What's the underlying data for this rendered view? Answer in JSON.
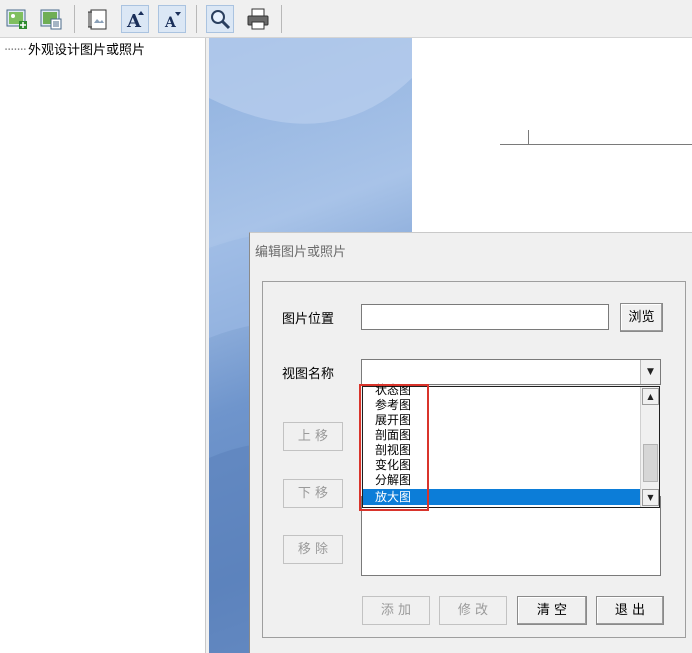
{
  "toolbar": {
    "icons": [
      "add-image-icon",
      "insert-image-icon",
      "page-frame-icon",
      "font-increase-icon",
      "font-decrease-icon",
      "zoom-icon",
      "print-icon"
    ],
    "font_increase_glyph": "A",
    "font_decrease_glyph": "A"
  },
  "tree": {
    "item_label": "外观设计图片或照片",
    "dots": "·······"
  },
  "dialog": {
    "title": "编辑图片或照片",
    "image_location_label": "图片位置",
    "image_location_value": "",
    "browse_label": "浏览",
    "view_name_label": "视图名称",
    "view_name_value": "",
    "dropdown_options": [
      "状态图",
      "参考图",
      "展开图",
      "剖面图",
      "剖视图",
      "变化图",
      "分解图",
      "放大图"
    ],
    "selected_option": "放大图",
    "move_up_label": "上 移",
    "move_down_label": "下 移",
    "remove_label": "移 除",
    "add_label": "添 加",
    "modify_label": "修 改",
    "clear_label": "清 空",
    "exit_label": "退 出"
  },
  "colors": {
    "selection": "#0c7dd8",
    "highlight_border": "#d9342b",
    "panel_blue": "#6f95cc"
  }
}
